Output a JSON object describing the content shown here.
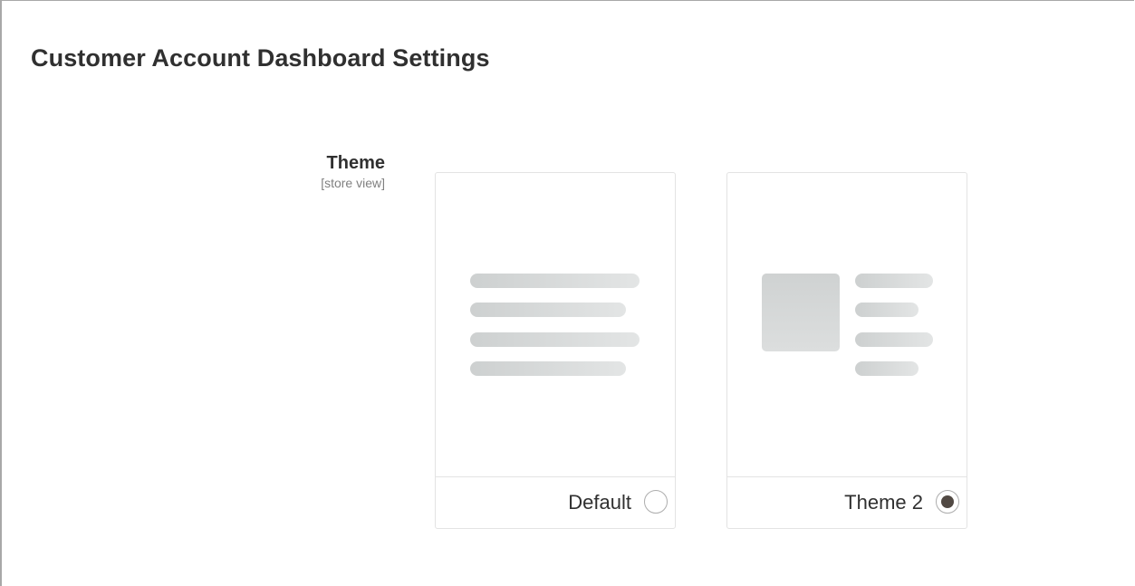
{
  "section": {
    "title": "Customer Account Dashboard Settings"
  },
  "theme_field": {
    "label": "Theme",
    "scope": "[store view]",
    "options": [
      {
        "label": "Default",
        "selected": false,
        "preview": "text-lines"
      },
      {
        "label": "Theme 2",
        "selected": true,
        "preview": "image-with-text-lines"
      }
    ]
  },
  "colors": {
    "text": "#303030",
    "scope_text": "#808080",
    "card_border": "#e3e3e3",
    "radio_checked": "#514943",
    "placeholder_gray": "#d3d6d6"
  }
}
